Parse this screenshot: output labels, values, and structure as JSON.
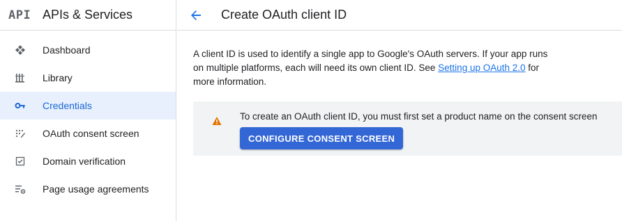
{
  "sidebar": {
    "logo_text": "API",
    "title": "APIs & Services",
    "items": [
      {
        "label": "Dashboard",
        "icon": "dashboard-icon",
        "active": false
      },
      {
        "label": "Library",
        "icon": "library-icon",
        "active": false
      },
      {
        "label": "Credentials",
        "icon": "key-icon",
        "active": true
      },
      {
        "label": "OAuth consent screen",
        "icon": "consent-icon",
        "active": false
      },
      {
        "label": "Domain verification",
        "icon": "checkbox-icon",
        "active": false
      },
      {
        "label": "Page usage agreements",
        "icon": "settings-list-icon",
        "active": false
      }
    ]
  },
  "header": {
    "back_icon": "arrow-back-icon",
    "title": "Create OAuth client ID"
  },
  "main": {
    "intro_before_link": "A client ID is used to identify a single app to Google's OAuth servers. If your app runs on multiple platforms, each will need its own client ID. See ",
    "intro_link": "Setting up OAuth 2.0",
    "intro_after_link": " for more information.",
    "notice": {
      "icon": "warning-icon",
      "text": "To create an OAuth client ID, you must first set a product name on the consent screen",
      "button_label": "CONFIGURE CONSENT SCREEN"
    }
  },
  "colors": {
    "accent": "#1a73e8",
    "active_bg": "#e8f0fe",
    "active_text": "#1967d2",
    "button_bg": "#3367d6",
    "warning": "#e37400"
  }
}
